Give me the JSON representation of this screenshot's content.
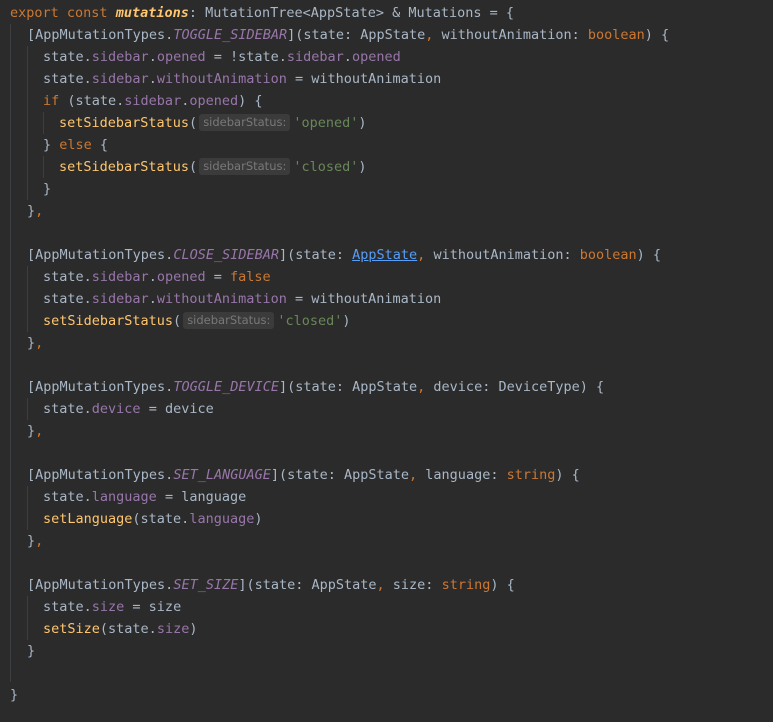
{
  "code": {
    "l1": {
      "export": "export",
      "const": "const",
      "name": "mutations",
      "colon": ":",
      "type": "MutationTree<AppState> & Mutations = {"
    },
    "l2": {
      "open": "[AppMutationTypes.",
      "key": "TOGGLE_SIDEBAR",
      "close": "](state: AppState",
      "comma": ",",
      "param": " withoutAnimation: ",
      "ptype": "boolean",
      "end": ") {"
    },
    "l3": {
      "a": "state.",
      "b": "sidebar",
      "c": ".",
      "d": "opened",
      "e": " = !state.",
      "f": "sidebar",
      "g": ".",
      "h": "opened"
    },
    "l4": {
      "a": "state.",
      "b": "sidebar",
      "c": ".",
      "d": "withoutAnimation",
      "e": " = withoutAnimation"
    },
    "l5": {
      "if": "if",
      "a": " (state.",
      "b": "sidebar",
      "c": ".",
      "d": "opened",
      "e": ") {"
    },
    "l6": {
      "fn": "setSidebarStatus",
      "p": "(",
      "hint": "sidebarStatus:",
      "arg": "'opened'",
      "e": ")"
    },
    "l7": {
      "a": "} ",
      "else": "else",
      "b": " {"
    },
    "l8": {
      "fn": "setSidebarStatus",
      "p": "(",
      "hint": "sidebarStatus:",
      "arg": "'closed'",
      "e": ")"
    },
    "l9": {
      "a": "}"
    },
    "l10": {
      "a": "}",
      "comma": ","
    },
    "l12": {
      "open": "[AppMutationTypes.",
      "key": "CLOSE_SIDEBAR",
      "close": "](state: ",
      "link": "AppState",
      "comma": ",",
      "param": " withoutAnimation: ",
      "ptype": "boolean",
      "end": ") {"
    },
    "l13": {
      "a": "state.",
      "b": "sidebar",
      "c": ".",
      "d": "opened",
      "e": " = ",
      "f": "false"
    },
    "l14": {
      "a": "state.",
      "b": "sidebar",
      "c": ".",
      "d": "withoutAnimation",
      "e": " = withoutAnimation"
    },
    "l15": {
      "fn": "setSidebarStatus",
      "p": "(",
      "hint": "sidebarStatus:",
      "arg": "'closed'",
      "e": ")"
    },
    "l16": {
      "a": "}",
      "comma": ","
    },
    "l18": {
      "open": "[AppMutationTypes.",
      "key": "TOGGLE_DEVICE",
      "close": "](state: AppState",
      "comma": ",",
      "param": " device: DeviceType) {"
    },
    "l19": {
      "a": "state.",
      "b": "device",
      "c": " = device"
    },
    "l20": {
      "a": "}",
      "comma": ","
    },
    "l22": {
      "open": "[AppMutationTypes.",
      "key": "SET_LANGUAGE",
      "close": "](state: AppState",
      "comma": ",",
      "param": " language: ",
      "ptype": "string",
      "end": ") {"
    },
    "l23": {
      "a": "state.",
      "b": "language",
      "c": " = language"
    },
    "l24": {
      "fn": "setLanguage",
      "a": "(state.",
      "b": "language",
      "c": ")"
    },
    "l25": {
      "a": "}",
      "comma": ","
    },
    "l27": {
      "open": "[AppMutationTypes.",
      "key": "SET_SIZE",
      "close": "](state: AppState",
      "comma": ",",
      "param": " size: ",
      "ptype": "string",
      "end": ") {"
    },
    "l28": {
      "a": "state.",
      "b": "size",
      "c": " = size"
    },
    "l29": {
      "fn": "setSize",
      "a": "(state.",
      "b": "size",
      "c": ")"
    },
    "l30": {
      "a": "}"
    },
    "l32": {
      "a": "}"
    }
  }
}
